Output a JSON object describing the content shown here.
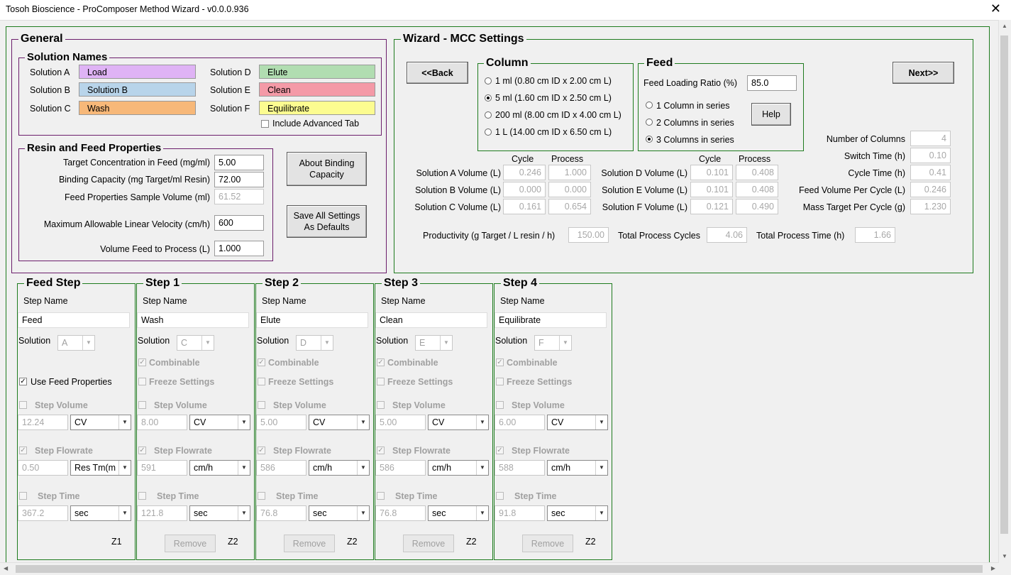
{
  "window": {
    "title": "Tosoh Bioscience - ProComposer Method Wizard - v0.0.0.936",
    "close": "✕"
  },
  "general": {
    "legend": "General",
    "solution_names": {
      "legend": "Solution Names",
      "items": [
        {
          "label": "Solution A",
          "value": "Load",
          "color": "#dfb3f5"
        },
        {
          "label": "Solution B",
          "value": "Solution B",
          "color": "#b8d4ea"
        },
        {
          "label": "Solution C",
          "value": "Wash",
          "color": "#f7b879"
        },
        {
          "label": "Solution D",
          "value": "Elute",
          "color": "#b1ddb1"
        },
        {
          "label": "Solution E",
          "value": "Clean",
          "color": "#f49aa7"
        },
        {
          "label": "Solution F",
          "value": "Equilibrate",
          "color": "#fcfc90"
        }
      ],
      "include_advanced_tab": "Include Advanced Tab"
    },
    "resin": {
      "legend": "Resin and Feed Properties",
      "target_conc_label": "Target Concentration in Feed (mg/ml)",
      "target_conc": "5.00",
      "binding_cap_label": "Binding Capacity (mg Target/ml Resin)",
      "binding_cap": "72.00",
      "sample_vol_label": "Feed Properties Sample Volume (ml)",
      "sample_vol": "61.52",
      "max_velocity_label": "Maximum Allowable Linear Velocity (cm/h)",
      "max_velocity": "600",
      "volume_feed_label": "Volume Feed to Process (L)",
      "volume_feed": "1.000"
    },
    "about_binding": "About Binding Capacity",
    "save_defaults": "Save All Settings As Defaults"
  },
  "wizard": {
    "legend": "Wizard - MCC Settings",
    "back": "<<Back",
    "next": "Next>>",
    "column": {
      "legend": "Column",
      "options": [
        "1 ml (0.80 cm ID x 2.00 cm L)",
        "5 ml (1.60 cm ID x 2.50 cm L)",
        "200 ml (8.00 cm ID x 4.00 cm L)",
        "1 L (14.00 cm ID x 6.50 cm L)"
      ],
      "selected_index": 1
    },
    "feed": {
      "legend": "Feed",
      "loading_ratio_label": "Feed Loading Ratio (%)",
      "loading_ratio": "85.0",
      "options": [
        "1 Column in series",
        "2 Columns in series",
        "3 Columns in series"
      ],
      "selected_index": 2,
      "help": "Help"
    },
    "stats": [
      {
        "label": "Number of Columns",
        "value": "4"
      },
      {
        "label": "Switch Time (h)",
        "value": "0.10"
      },
      {
        "label": "Cycle Time (h)",
        "value": "0.41"
      },
      {
        "label": "Feed Volume Per Cycle (L)",
        "value": "0.246"
      },
      {
        "label": "Mass Target Per Cycle (g)",
        "value": "1.230"
      }
    ],
    "cycle_header": "Cycle",
    "process_header": "Process",
    "volumes_left": [
      {
        "label": "Solution A Volume (L)",
        "cycle": "0.246",
        "process": "1.000"
      },
      {
        "label": "Solution B Volume (L)",
        "cycle": "0.000",
        "process": "0.000"
      },
      {
        "label": "Solution C Volume (L)",
        "cycle": "0.161",
        "process": "0.654"
      }
    ],
    "volumes_right": [
      {
        "label": "Solution D Volume (L)",
        "cycle": "0.101",
        "process": "0.408"
      },
      {
        "label": "Solution E Volume (L)",
        "cycle": "0.101",
        "process": "0.408"
      },
      {
        "label": "Solution F Volume (L)",
        "cycle": "0.121",
        "process": "0.490"
      }
    ],
    "productivity_label": "Productivity (g Target / L resin / h)",
    "productivity": "150.00",
    "total_cycles_label": "Total Process Cycles",
    "total_cycles": "4.06",
    "total_time_label": "Total Process Time (h)",
    "total_time": "1.66"
  },
  "steps": [
    {
      "legend": "Feed Step",
      "step_name_label": "Step Name",
      "name": "Feed",
      "solution_label": "Solution",
      "solution": "A",
      "use_feed": "Use Feed Properties",
      "volume_label": "Step Volume",
      "volume": "12.24",
      "volume_unit": "CV",
      "flow_label": "Step Flowrate",
      "flow": "0.50",
      "flow_unit": "Res Tm(m",
      "time_label": "Step Time",
      "time": "367.2",
      "time_unit": "sec",
      "zone": "Z1"
    },
    {
      "legend": "Step 1",
      "step_name_label": "Step Name",
      "name": "Wash",
      "solution_label": "Solution",
      "solution": "C",
      "combinable": "Combinable",
      "freeze": "Freeze Settings",
      "volume_label": "Step Volume",
      "volume": "8.00",
      "volume_unit": "CV",
      "flow_label": "Step Flowrate",
      "flow": "591",
      "flow_unit": "cm/h",
      "time_label": "Step Time",
      "time": "121.8",
      "time_unit": "sec",
      "remove": "Remove",
      "zone": "Z2"
    },
    {
      "legend": "Step 2",
      "step_name_label": "Step Name",
      "name": "Elute",
      "solution_label": "Solution",
      "solution": "D",
      "combinable": "Combinable",
      "freeze": "Freeze Settings",
      "volume_label": "Step Volume",
      "volume": "5.00",
      "volume_unit": "CV",
      "flow_label": "Step Flowrate",
      "flow": "586",
      "flow_unit": "cm/h",
      "time_label": "Step Time",
      "time": "76.8",
      "time_unit": "sec",
      "remove": "Remove",
      "zone": "Z2"
    },
    {
      "legend": "Step 3",
      "step_name_label": "Step Name",
      "name": "Clean",
      "solution_label": "Solution",
      "solution": "E",
      "combinable": "Combinable",
      "freeze": "Freeze Settings",
      "volume_label": "Step Volume",
      "volume": "5.00",
      "volume_unit": "CV",
      "flow_label": "Step Flowrate",
      "flow": "586",
      "flow_unit": "cm/h",
      "time_label": "Step Time",
      "time": "76.8",
      "time_unit": "sec",
      "remove": "Remove",
      "zone": "Z2"
    },
    {
      "legend": "Step 4",
      "step_name_label": "Step Name",
      "name": "Equilibrate",
      "solution_label": "Solution",
      "solution": "F",
      "combinable": "Combinable",
      "freeze": "Freeze Settings",
      "volume_label": "Step Volume",
      "volume": "6.00",
      "volume_unit": "CV",
      "flow_label": "Step Flowrate",
      "flow": "588",
      "flow_unit": "cm/h",
      "time_label": "Step Time",
      "time": "91.8",
      "time_unit": "sec",
      "remove": "Remove",
      "zone": "Z2"
    }
  ]
}
